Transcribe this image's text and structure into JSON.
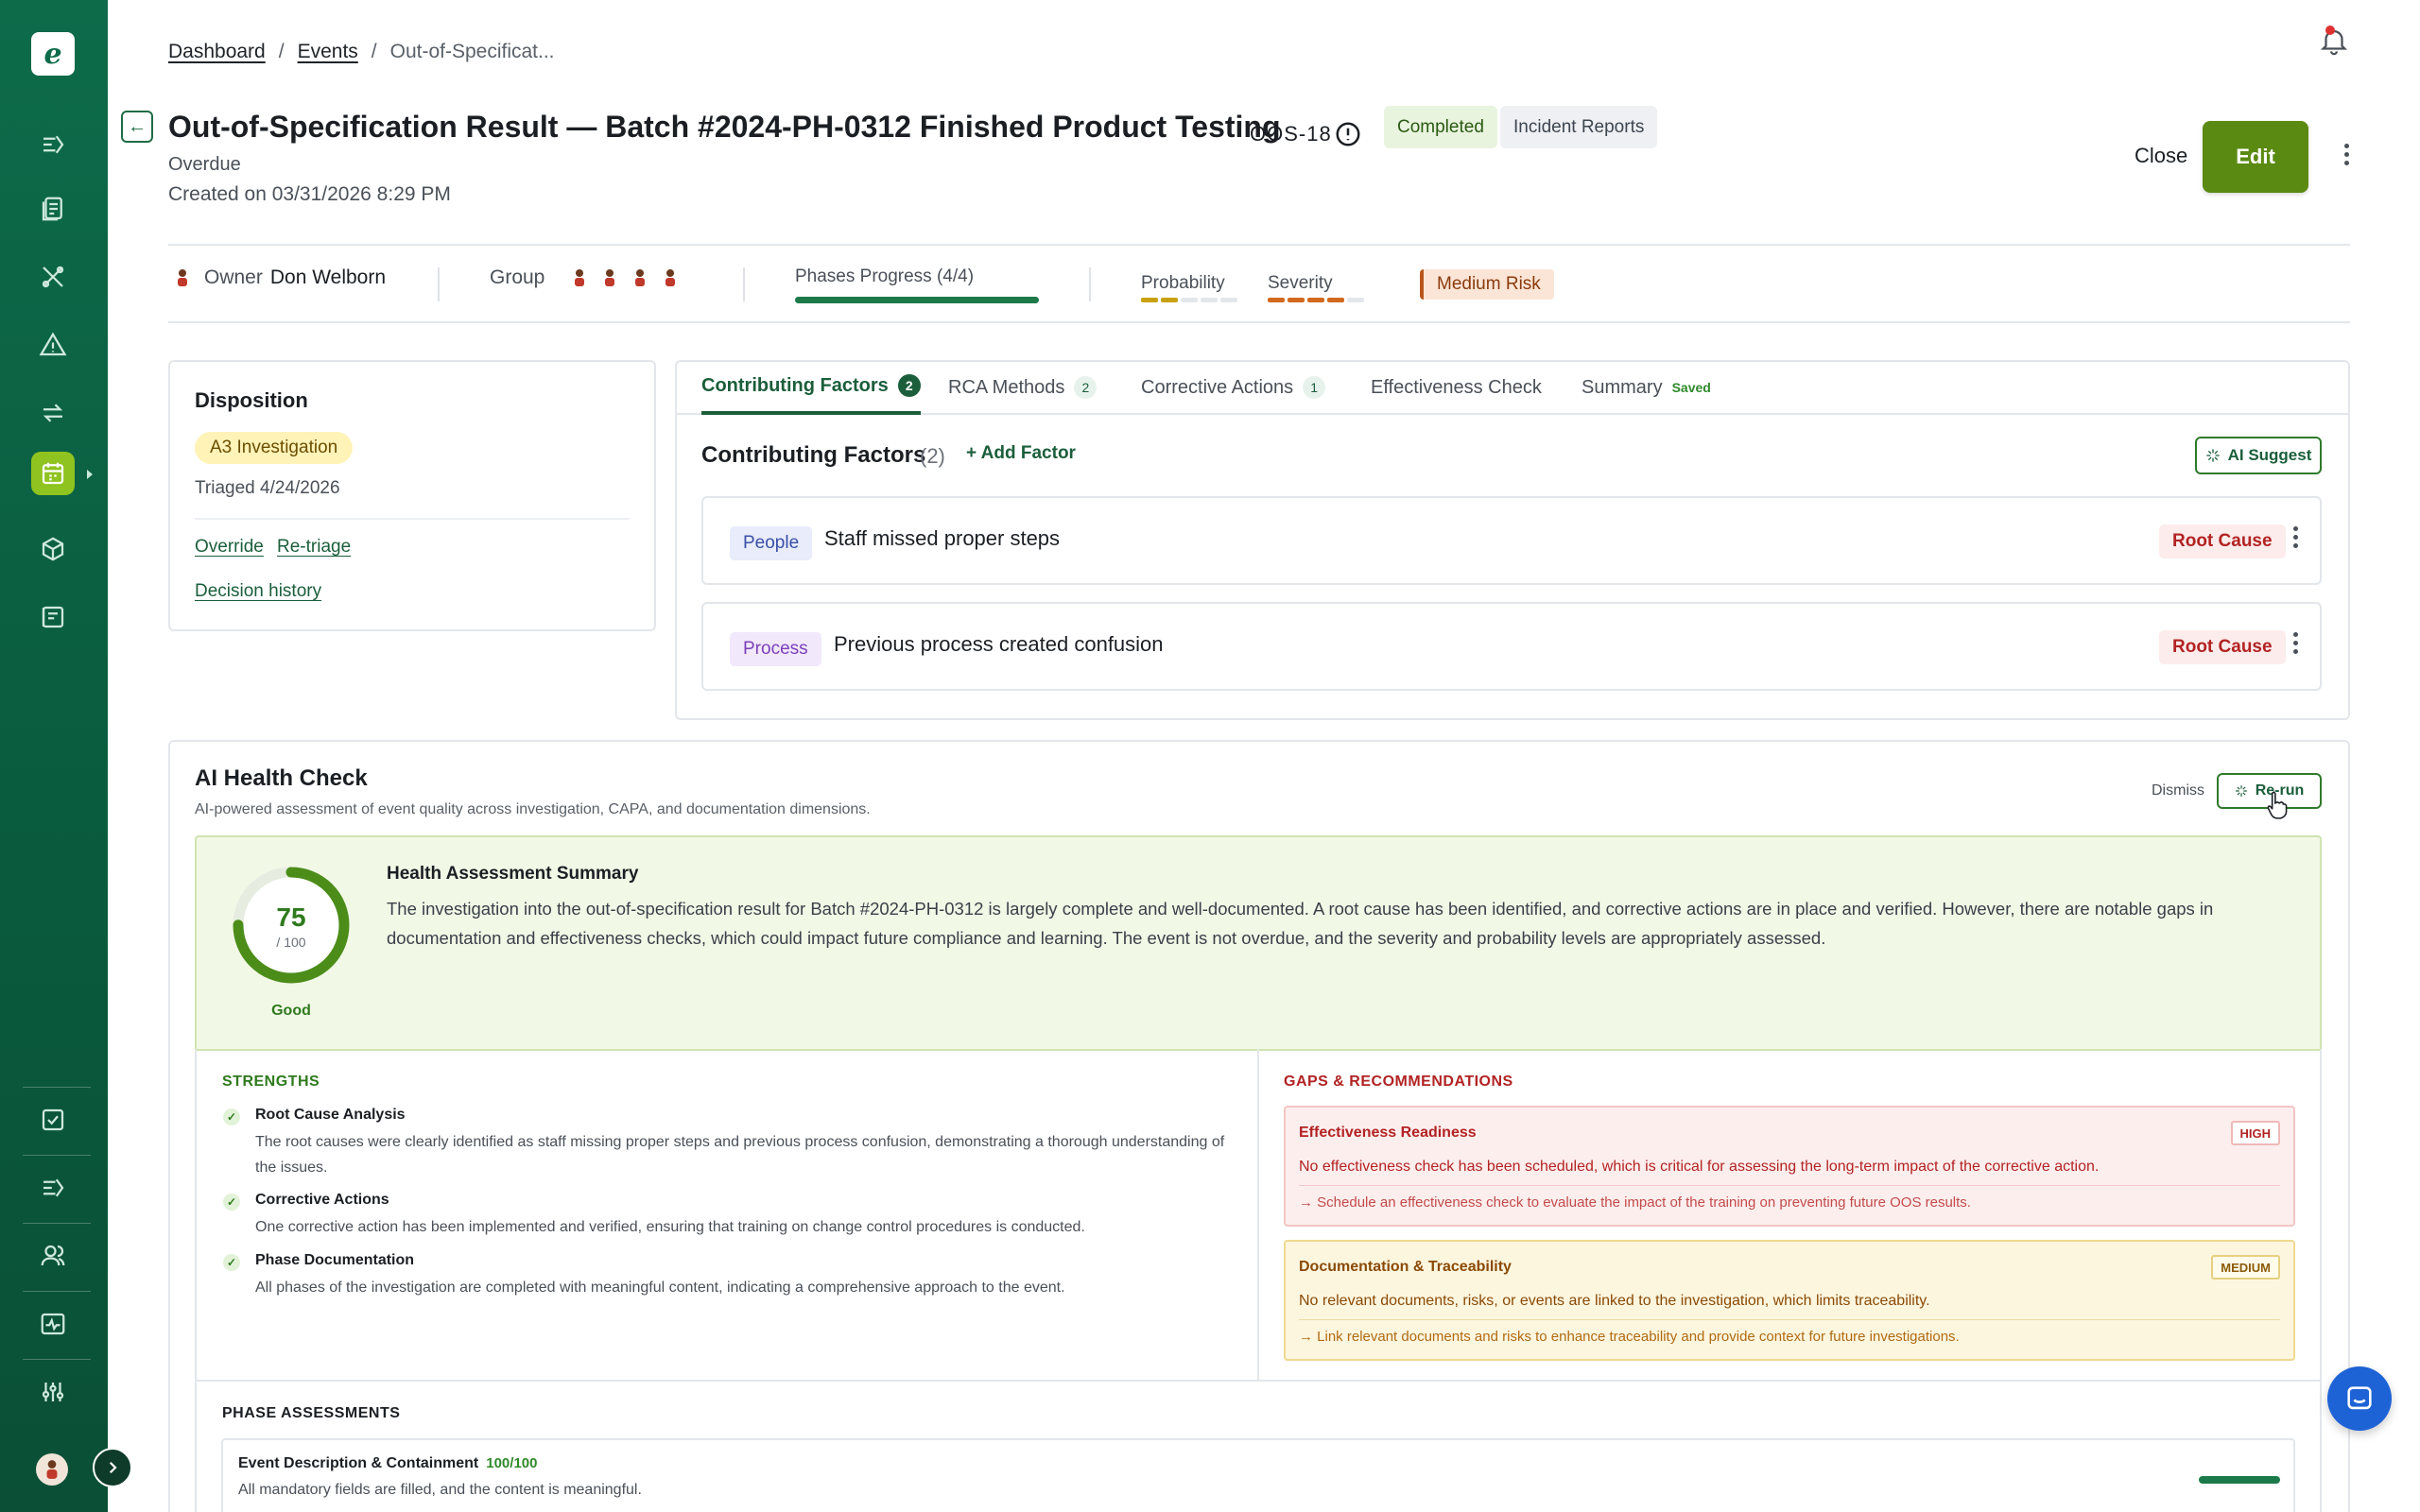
{
  "sidebar": {
    "logo": "e",
    "nav_icons": [
      "events-flow-icon",
      "documents-icon",
      "tools-icon",
      "alert-triangle-icon",
      "transfer-icon",
      "calendar-icon",
      "package-icon",
      "form-icon",
      "checklist-icon",
      "flow-icon",
      "users-icon",
      "monitor-icon",
      "sliders-icon"
    ],
    "active_item": "calendar-icon"
  },
  "breadcrumb": {
    "items": [
      "Dashboard",
      "Events",
      "Out-of-Specificat..."
    ]
  },
  "header": {
    "title": "Out-of-Specification Result — Batch #2024-PH-0312 Finished Product Testing",
    "event_id": "OOS-18",
    "status_pill": "Completed",
    "category_pill": "Incident Reports",
    "overdue": "Overdue",
    "created": "Created on 03/31/2026 8:29 PM",
    "close_label": "Close",
    "edit_label": "Edit"
  },
  "meta": {
    "owner_label": "Owner",
    "owner_name": "Don Welborn",
    "group_label": "Group",
    "group_count": 4,
    "phases_label": "Phases Progress (4/4)",
    "phases_progress": 1.0,
    "probability_label": "Probability",
    "probability_level": 2,
    "severity_label": "Severity",
    "severity_level": 4,
    "level_max": 5,
    "risk": "Medium Risk"
  },
  "disposition": {
    "title": "Disposition",
    "badge": "A3 Investigation",
    "triaged": "Triaged 4/24/2026",
    "override": "Override",
    "retriage": "Re-triage",
    "history": "Decision history"
  },
  "tabs": [
    {
      "label": "Contributing Factors",
      "count": "2"
    },
    {
      "label": "RCA Methods",
      "count": "2"
    },
    {
      "label": "Corrective Actions",
      "count": "1"
    },
    {
      "label": "Effectiveness Check",
      "count": ""
    },
    {
      "label": "Summary",
      "count": "",
      "note": "Saved"
    }
  ],
  "factors": {
    "title": "Contributing Factors",
    "count": "(2)",
    "add_label": "+ Add Factor",
    "ai_suggest": "AI Suggest",
    "items": [
      {
        "tag": "People",
        "text": "Staff missed proper steps",
        "badge": "Root Cause"
      },
      {
        "tag": "Process",
        "text": "Previous process created confusion",
        "badge": "Root Cause"
      }
    ]
  },
  "health": {
    "title": "AI Health Check",
    "subtitle": "AI-powered assessment of event quality across investigation, CAPA, and documentation dimensions.",
    "dismiss": "Dismiss",
    "rerun": "Re-run",
    "score": "75",
    "score_of": "/ 100",
    "score_value": 75,
    "score_label": "Good",
    "summary_title": "Health Assessment Summary",
    "summary_text": "The investigation into the out-of-specification result for Batch #2024-PH-0312 is largely complete and well-documented. A root cause has been identified, and corrective actions are in place and verified. However, there are notable gaps in documentation and effectiveness checks, which could impact future compliance and learning. The event is not overdue, and the severity and probability levels are appropriately assessed.",
    "strengths_head": "STRENGTHS",
    "strengths": [
      {
        "title": "Root Cause Analysis",
        "text": "The root causes were clearly identified as staff missing proper steps and previous process confusion, demonstrating a thorough understanding of the issues."
      },
      {
        "title": "Corrective Actions",
        "text": "One corrective action has been implemented and verified, ensuring that training on change control procedures is conducted."
      },
      {
        "title": "Phase Documentation",
        "text": "All phases of the investigation are completed with meaningful content, indicating a comprehensive approach to the event."
      }
    ],
    "gaps_head": "GAPS & RECOMMENDATIONS",
    "gaps": [
      {
        "title": "Effectiveness Readiness",
        "level": "HIGH",
        "text": "No effectiveness check has been scheduled, which is critical for assessing the long-term impact of the corrective action.",
        "rec": "→ Schedule an effectiveness check to evaluate the impact of the training on preventing future OOS results."
      },
      {
        "title": "Documentation & Traceability",
        "level": "MEDIUM",
        "text": "No relevant documents, risks, or events are linked to the investigation, which limits traceability.",
        "rec": "→ Link relevant documents and risks to enhance traceability and provide context for future investigations."
      }
    ],
    "phase_head": "PHASE ASSESSMENTS",
    "phases": [
      {
        "title": "Event Description & Containment",
        "score": "100/100",
        "text": "All mandatory fields are filled, and the content is meaningful."
      }
    ]
  },
  "colors": {
    "brand": "#0d6b4a",
    "accent": "#5b8a12",
    "probability": "#c9a10f",
    "severity": "#d2691e"
  }
}
